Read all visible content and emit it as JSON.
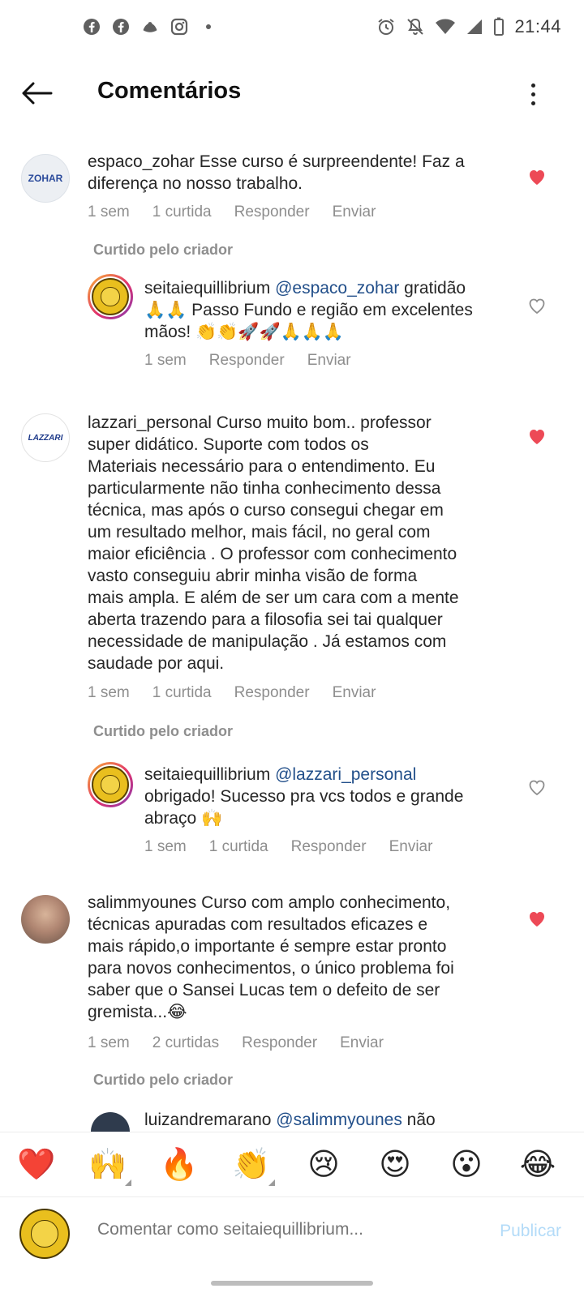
{
  "status_bar": {
    "time": "21:44",
    "left_icons": [
      "facebook-icon",
      "facebook-icon",
      "onlyfans-icon",
      "instagram-icon",
      "dot-icon"
    ],
    "right_icons": [
      "alarm-icon",
      "silent-icon",
      "wifi-icon",
      "signal-icon",
      "battery-icon"
    ]
  },
  "header": {
    "title": "Comentários"
  },
  "comments": [
    {
      "username": "espaco_zohar",
      "avatar_text": "ZOHAR",
      "lines": [
        "Esse curso é surpreendente! Faz a",
        "diferença no nosso trabalho."
      ],
      "time": "1 sem",
      "likes": "1 curtida",
      "reply": "Responder",
      "send": "Enviar",
      "liked": true,
      "creator_liked": "Curtido pelo criador"
    },
    {
      "username": "seitaiequillibrium",
      "mention": "@espaco_zohar",
      "lines": [
        "gratidão",
        "🙏🙏 Passo Fundo e região em excelentes",
        "mãos! 👏👏🚀🚀🙏🙏🙏"
      ],
      "time": "1 sem",
      "reply": "Responder",
      "send": "Enviar",
      "liked": false
    },
    {
      "username": "lazzari_personal",
      "avatar_text": "LAZZARI",
      "lines": [
        "Curso muito bom.. professor",
        "super didático. Suporte com todos os",
        "Materiais  necessário para o entendimento. Eu",
        "particularmente não tinha conhecimento dessa",
        "técnica, mas após o curso consegui chegar em",
        "um resultado melhor, mais fácil, no geral com",
        "maior eficiência . O professor com conhecimento",
        "vasto conseguiu abrir minha visão  de forma",
        "mais ampla. E além de ser um cara com a mente",
        "aberta trazendo para a filosofia sei tai qualquer",
        "necessidade de manipulação .  Já estamos com",
        "saudade por aqui."
      ],
      "time": "1 sem",
      "likes": "1 curtida",
      "reply": "Responder",
      "send": "Enviar",
      "liked": true,
      "creator_liked": "Curtido pelo criador"
    },
    {
      "username": "seitaiequillibrium",
      "mention": "@lazzari_personal",
      "lines": [
        "",
        "obrigado! Sucesso pra vcs todos e grande",
        "abraço 🙌"
      ],
      "time": "1 sem",
      "likes": "1 curtida",
      "reply": "Responder",
      "send": "Enviar",
      "liked": false
    },
    {
      "username": "salimmyounes",
      "lines": [
        "Curso com amplo conhecimento,",
        "técnicas apuradas com resultados eficazes e",
        "mais rápido,o importante é sempre estar pronto",
        "para novos conhecimentos, o único problema foi",
        "saber que o Sansei Lucas tem o defeito de ser",
        "gremista...😂"
      ],
      "time": "1 sem",
      "likes": "2 curtidas",
      "reply": "Responder",
      "send": "Enviar",
      "liked": true,
      "creator_liked": "Curtido pelo criador"
    },
    {
      "username": "luizandremarano",
      "mention": "@salimmyounes",
      "lines": [
        "não"
      ]
    }
  ],
  "emoji_bar": [
    "❤️",
    "🙌",
    "🔥",
    "👏",
    "😢",
    "😍",
    "😮",
    "😂"
  ],
  "composer": {
    "placeholder": "Comentar como seitaiequillibrium...",
    "publish": "Publicar"
  },
  "colors": {
    "like_red": "#ed4956",
    "mention_blue": "#224f8a",
    "publish_disabled": "#b3dbf8",
    "meta_gray": "#8e8e8e"
  }
}
